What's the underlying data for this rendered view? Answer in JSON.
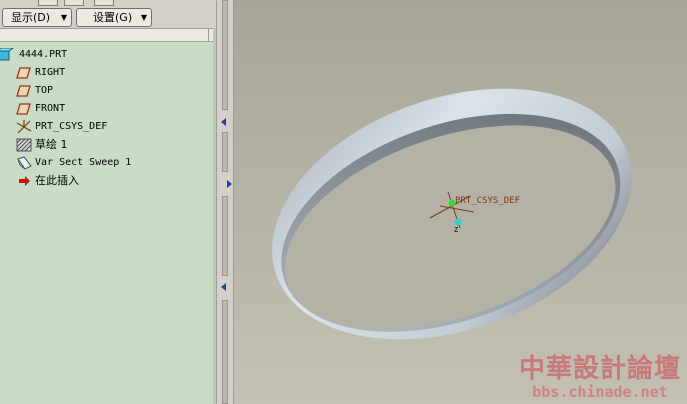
{
  "toolbar": {
    "show_menu": "显示(D)",
    "settings_menu": "设置(G)"
  },
  "tree": {
    "root": "4444.PRT",
    "items": [
      {
        "label": "RIGHT",
        "icon": "datum-plane-icon"
      },
      {
        "label": "TOP",
        "icon": "datum-plane-icon"
      },
      {
        "label": "FRONT",
        "icon": "datum-plane-icon"
      },
      {
        "label": "PRT_CSYS_DEF",
        "icon": "coordinate-system-icon"
      },
      {
        "label": "草绘 1",
        "icon": "sketch-icon"
      },
      {
        "label": "Var Sect Sweep 1",
        "icon": "sweep-feature-icon"
      },
      {
        "label": "在此插入",
        "icon": "insert-here-arrow-icon"
      }
    ]
  },
  "viewport": {
    "csys_label": "PRT_CSYS_DEF",
    "axis_label": "Z"
  },
  "watermark": {
    "title": "中華設計論壇",
    "url": "bbs.chinade.net"
  },
  "colors": {
    "tree_background": "#c9ddc6",
    "viewport_background": "#b4b1a6",
    "ring_face": "#c9d2da",
    "insert_arrow": "#c81010",
    "watermark": "#c77a7a"
  }
}
